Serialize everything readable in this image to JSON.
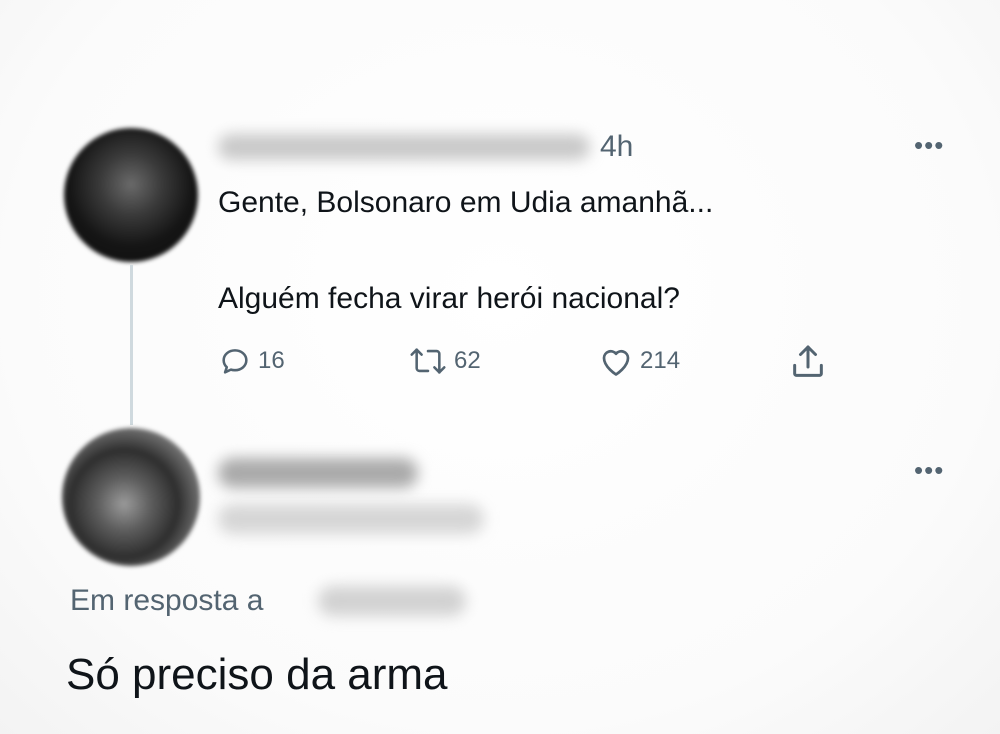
{
  "tweet": {
    "time": "4h",
    "text_line_1": "Gente, Bolsonaro em Udia amanhã...",
    "text_line_2": "Alguém fecha virar herói nacional?",
    "more_icon": "more-horizontal-icon",
    "actions": {
      "reply_count": "16",
      "retweet_count": "62",
      "like_count": "214"
    }
  },
  "reply": {
    "more_icon": "more-horizontal-icon",
    "in_reply_to_label": "Em resposta a",
    "text": "Só preciso da arma"
  }
}
